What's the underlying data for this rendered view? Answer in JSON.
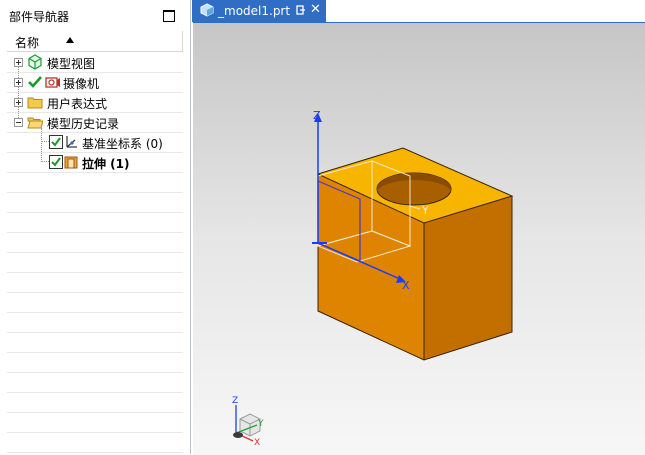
{
  "navigator": {
    "title": "部件导航器",
    "column_header": "名称",
    "items": [
      {
        "label": "模型视图",
        "icon": "model-views-icon"
      },
      {
        "label": "摄像机",
        "icon": "camera-icon"
      },
      {
        "label": "用户表达式",
        "icon": "folder-icon"
      },
      {
        "label": "模型历史记录",
        "icon": "open-folder-icon"
      },
      {
        "label": "基准坐标系 (0)",
        "icon": "datum-csys-icon"
      },
      {
        "label": "拉伸 (1)",
        "icon": "extrude-icon"
      }
    ]
  },
  "tab": {
    "title": "_model1.prt",
    "close_glyph": "✕"
  },
  "viewport": {
    "axis_labels": {
      "x": "X",
      "y": "Y",
      "z": "Z"
    },
    "triad_labels": {
      "x": "X",
      "y": "Y",
      "z": "Z"
    },
    "colors": {
      "top": "#f7b500",
      "front": "#de8400",
      "side": "#c36f00",
      "accent": "#2f6ec4"
    }
  }
}
